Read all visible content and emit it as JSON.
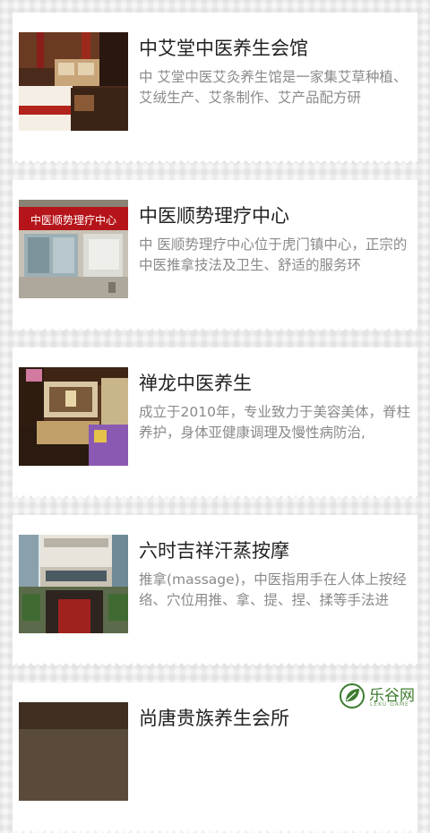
{
  "listings": [
    {
      "title": "中艾堂中医养生会馆",
      "description": "中 艾堂中医艾灸养生馆是一家集艾草种植、艾绒生产、艾条制作、艾产品配方研",
      "image_icon": "massage-room-photo"
    },
    {
      "title": "中医顺势理疗中心",
      "description": "中 医顺势理疗中心位于虎门镇中心，正宗的中医推拿技法及卫生、舒适的服务环",
      "image_icon": "storefront-photo",
      "sign_text": "中医顺势理疗中心"
    },
    {
      "title": "禅龙中医养生",
      "description": "成立于2010年，专业致力于美容美体，脊柱养护，身体亚健康调理及慢性病防治,",
      "image_icon": "reception-desk-photo"
    },
    {
      "title": "六时吉祥汗蒸按摩",
      "description": "推拿(massage)，中医指用手在人体上按经络、穴位用推、拿、提、捏、揉等手法进",
      "image_icon": "building-exterior-photo"
    },
    {
      "title": "尚唐贵族养生会所",
      "description": "",
      "image_icon": "partial-photo"
    }
  ],
  "watermark": {
    "text": "乐谷网",
    "subtext": "LEKU GAME"
  },
  "colors": {
    "title": "#222222",
    "description": "#8a8a8a",
    "card": "#ffffff",
    "background": "#ececec",
    "watermark": "#3d7c2f"
  }
}
